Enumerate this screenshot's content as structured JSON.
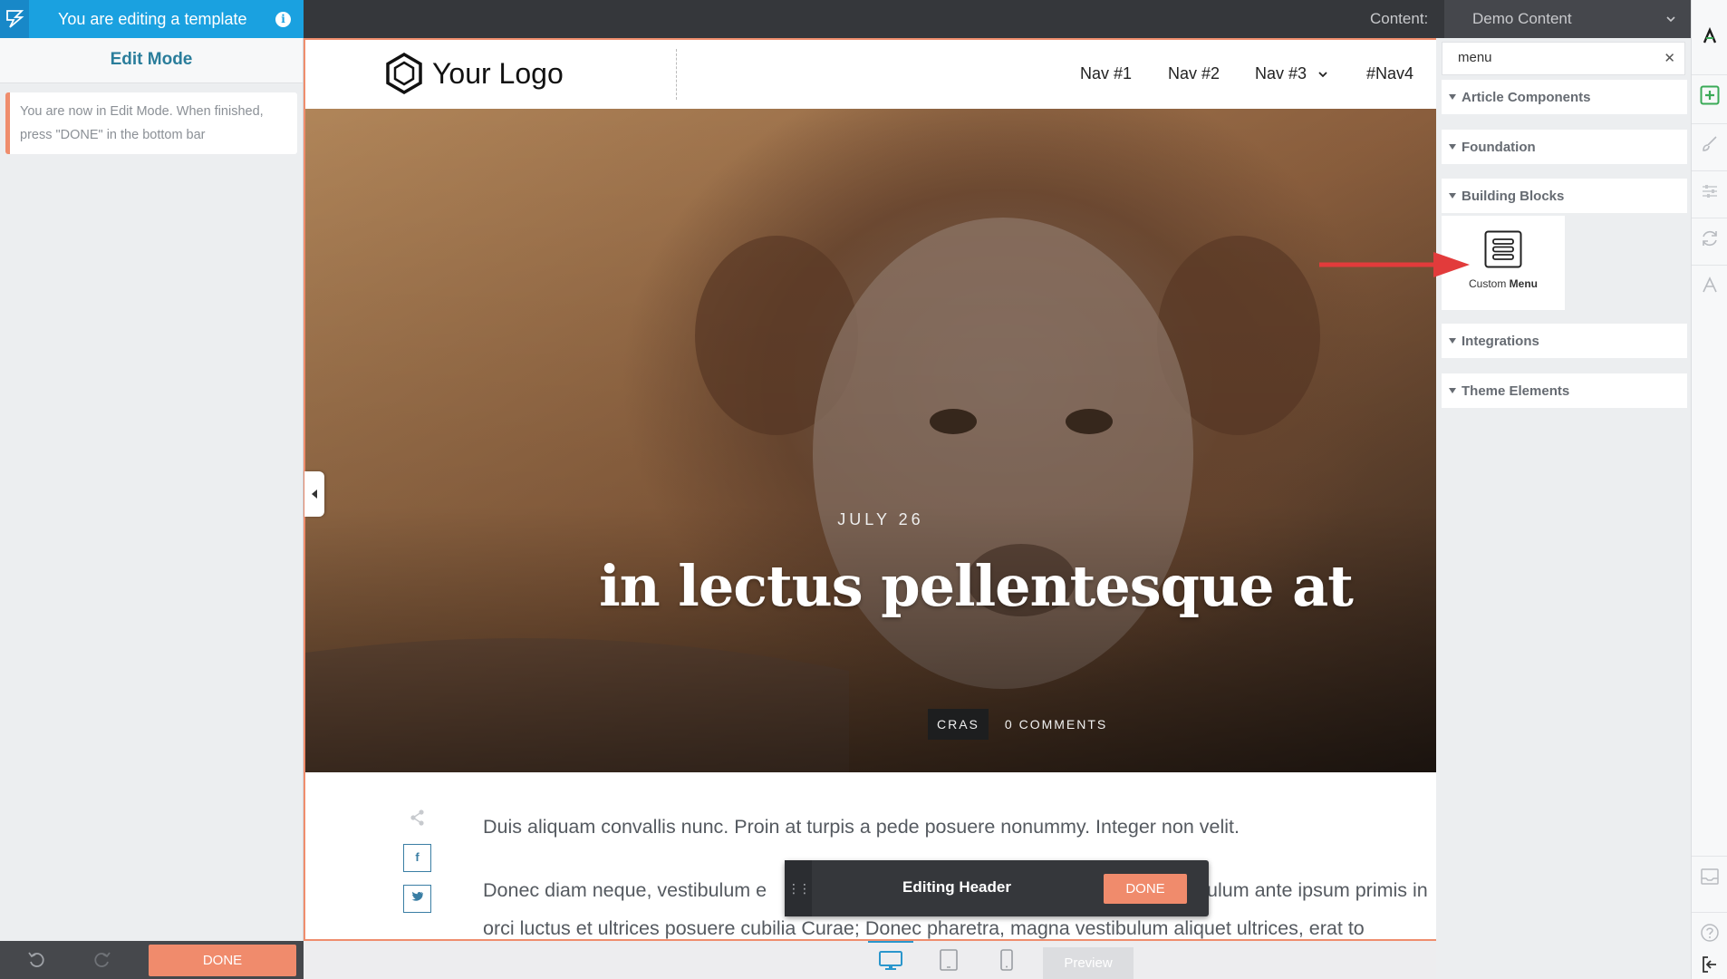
{
  "topbar": {
    "editing_title": "You are editing a template",
    "info_icon": "i",
    "content_label": "Content:",
    "content_value": "Demo Content"
  },
  "left_panel": {
    "heading": "Edit Mode",
    "notice_line1": "You are now in Edit Mode. When finished,",
    "notice_line2": "press \"DONE\" in the bottom bar",
    "done_label": "DONE"
  },
  "site": {
    "logo_text": "Your Logo",
    "nav": [
      "Nav #1",
      "Nav #2",
      "Nav #3",
      "#Nav4"
    ],
    "hero": {
      "date": "JULY 26",
      "title": "in lectus pellentesque at",
      "category": "CRAS",
      "comments": "0 COMMENTS"
    },
    "article": {
      "para1": "Duis aliquam convallis nunc. Proin at turpis a pede posuere nonummy. Integer non velit.",
      "para2_left": "Donec diam neque, vestibulum e",
      "para2_right": "ulum ante ipsum primis in",
      "para3": "orci luctus et ultrices posuere cubilia Curae; Donec pharetra, magna vestibulum aliquet ultrices, erat to"
    }
  },
  "editing_header": {
    "title": "Editing Header",
    "done_label": "DONE"
  },
  "bottom_bar": {
    "preview_label": "Preview"
  },
  "right_panel": {
    "search_value": "menu",
    "categories": [
      "Article Components",
      "Foundation",
      "Building Blocks",
      "Integrations",
      "Theme Elements"
    ],
    "block_label_normal": "Custom ",
    "block_label_bold": "Menu"
  },
  "colors": {
    "accent_blue": "#1aa1e0",
    "done_orange": "#f08b6c",
    "add_green": "#3aaa57",
    "arrow_red": "#e23b3b"
  }
}
